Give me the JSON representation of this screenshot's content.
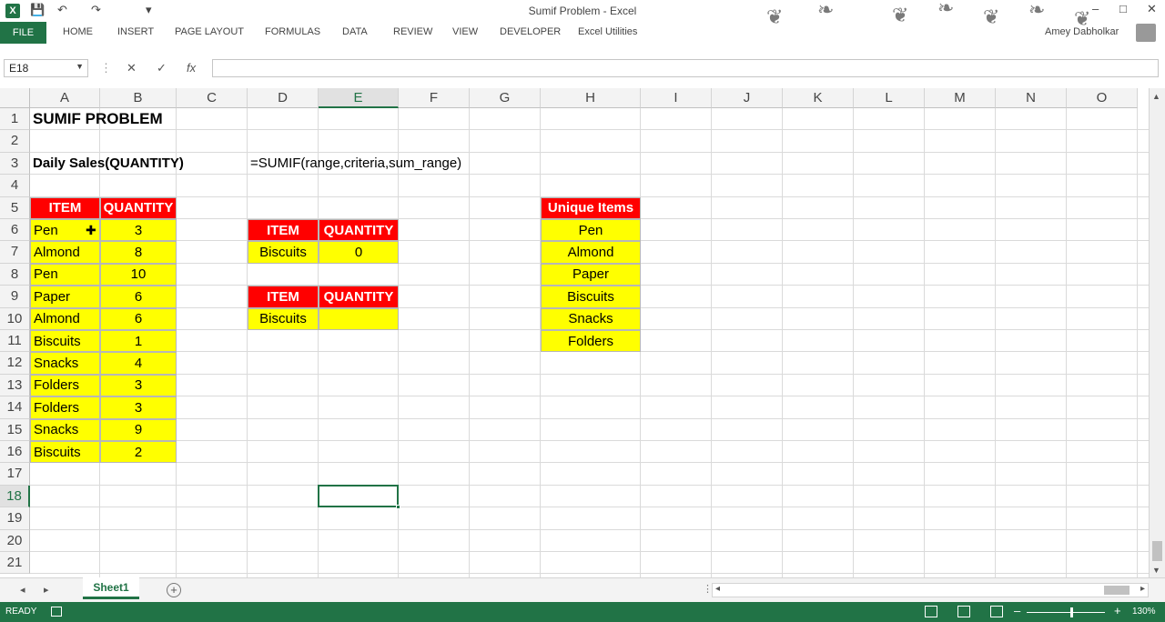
{
  "window": {
    "title": "Sumif Problem - Excel",
    "user_name": "Amey Dabholkar",
    "minimize_icon": "–",
    "restore_icon": "□",
    "close_icon": "✕"
  },
  "quick_access": {
    "save_icon": "💾",
    "undo_icon": "↶",
    "redo_icon": "↷",
    "customize_icon": "▾",
    "app_icon": "X"
  },
  "ribbon": {
    "tabs": [
      "FILE",
      "HOME",
      "INSERT",
      "PAGE LAYOUT",
      "FORMULAS",
      "DATA",
      "REVIEW",
      "VIEW",
      "DEVELOPER",
      "Excel Utilities"
    ]
  },
  "formula_bar": {
    "name_box": "E18",
    "cancel_icon": "✕",
    "enter_icon": "✓",
    "fx_label": "fx",
    "formula": ""
  },
  "grid": {
    "columns": [
      "A",
      "B",
      "C",
      "D",
      "E",
      "F",
      "G",
      "H",
      "I",
      "J",
      "K",
      "L",
      "M",
      "N",
      "O"
    ],
    "rows": [
      "1",
      "2",
      "3",
      "4",
      "5",
      "6",
      "7",
      "8",
      "9",
      "10",
      "11",
      "12",
      "13",
      "14",
      "15",
      "16",
      "17",
      "18",
      "19",
      "20",
      "21"
    ],
    "selected_column": "E",
    "selected_row": "18"
  },
  "cells": {
    "A1": "SUMIF PROBLEM",
    "A3": "Daily Sales(QUANTITY)",
    "D3": "=SUMIF(range,criteria,sum_range)",
    "A5": "ITEM",
    "B5": "QUANTITY",
    "A6": "Pen",
    "B6": "3",
    "A7": " Almond",
    "B7": "8",
    "A8": "Pen",
    "B8": "10",
    "A9": "Paper",
    "B9": "6",
    "A10": "Almond",
    "B10": "6",
    "A11": "Biscuits",
    "B11": "1",
    "A12": "Snacks",
    "B12": "4",
    "A13": " Folders",
    "B13": "3",
    "A14": "Folders",
    "B14": "3",
    "A15": " Snacks",
    "B15": "9",
    "A16": " Biscuits",
    "B16": "2",
    "D6": "ITEM",
    "E6": "QUANTITY",
    "D7": "Biscuits",
    "E7": "0",
    "D9": "ITEM",
    "E9": "QUANTITY",
    "D10": "Biscuits",
    "E10": "",
    "H5": "Unique Items",
    "H6": "Pen",
    "H7": "Almond",
    "H8": "Paper",
    "H9": "Biscuits",
    "H10": "Snacks",
    "H11": "Folders"
  },
  "sheets": {
    "tabs": [
      "Sheet1"
    ],
    "active": "Sheet1",
    "add_icon": "+",
    "prev_icon": "◂",
    "next_icon": "▸"
  },
  "status": {
    "ready": "READY",
    "zoom_minus": "–",
    "zoom_plus": "+",
    "zoom": "130%"
  },
  "colors": {
    "accent": "#217346",
    "header_red": "#ff0000",
    "cell_yellow": "#ffff00"
  }
}
